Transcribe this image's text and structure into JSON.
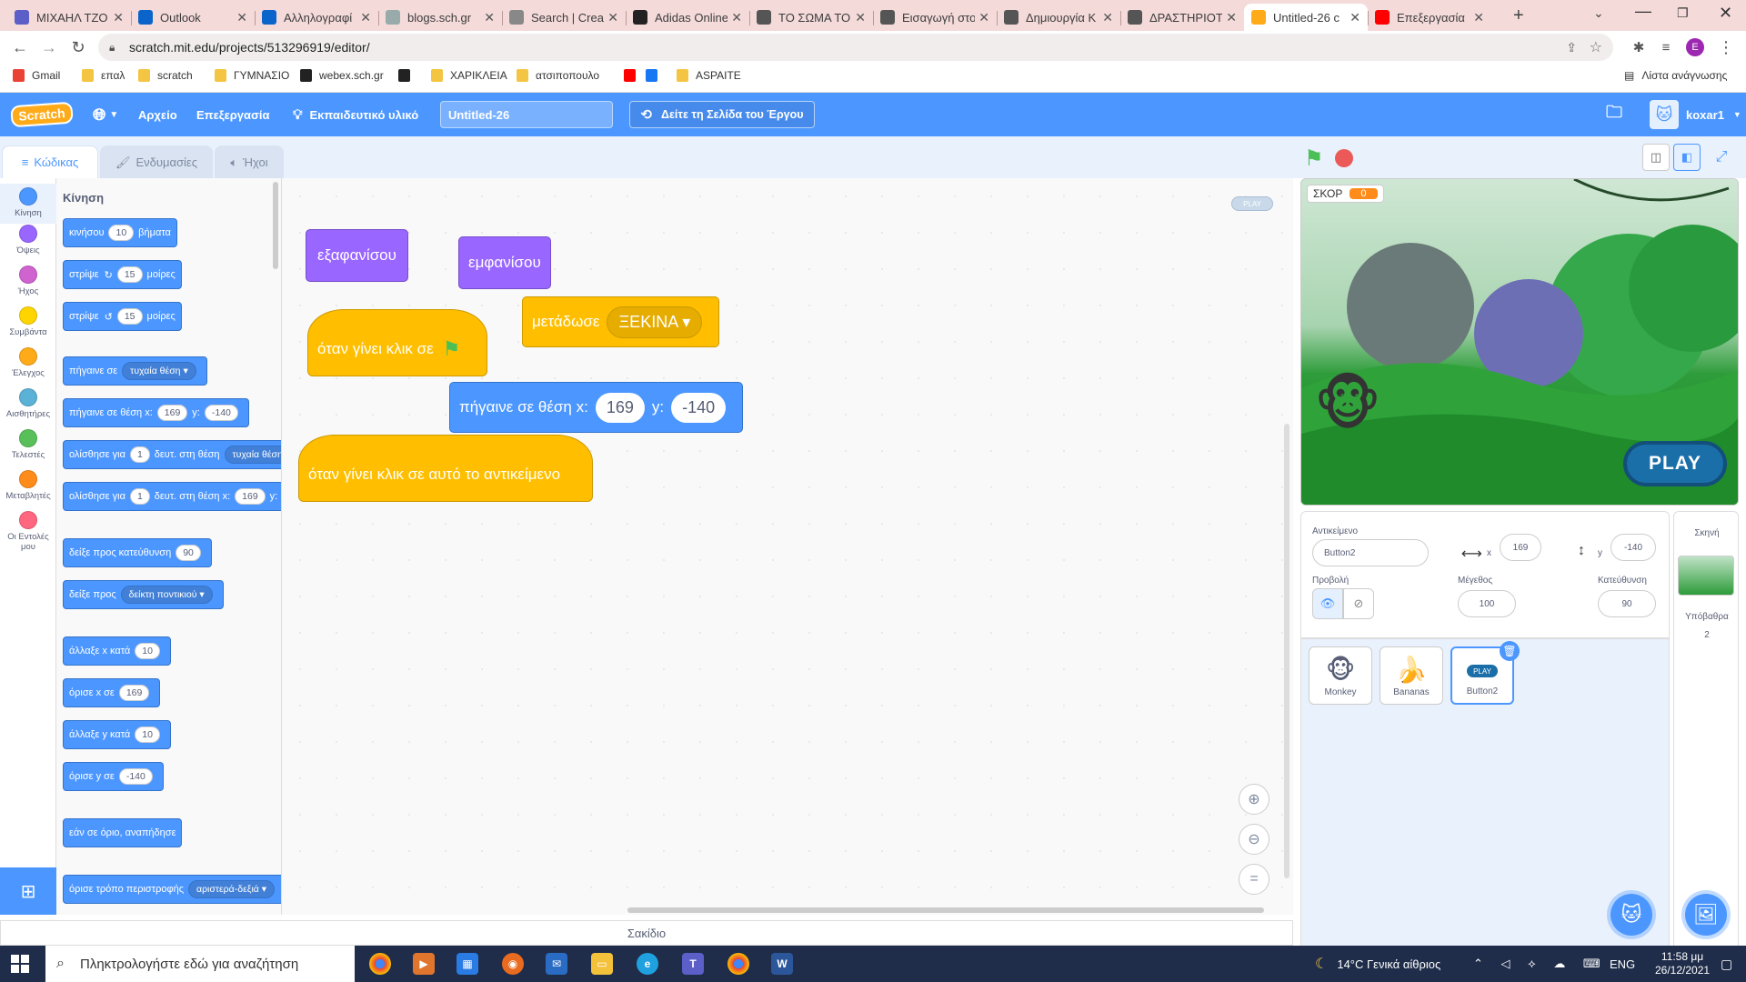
{
  "browser": {
    "tabs": [
      {
        "title": "ΜΙΧΑΗΛ ΤΖΟ",
        "color": "#5b5fc7"
      },
      {
        "title": "Outlook",
        "color": "#0a64c9"
      },
      {
        "title": "Αλληλογραφί",
        "color": "#0a64c9"
      },
      {
        "title": "blogs.sch.gr",
        "color": "#9aa"
      },
      {
        "title": "Search | Crea",
        "color": "#888"
      },
      {
        "title": "Adidas Online",
        "color": "#222"
      },
      {
        "title": "ΤΟ ΣΩΜΑ ΤΟ",
        "color": "#555"
      },
      {
        "title": "Εισαγωγή στο",
        "color": "#555"
      },
      {
        "title": "Δημιουργία Κ",
        "color": "#555"
      },
      {
        "title": "ΔΡΑΣΤΗΡΙΟΤ",
        "color": "#555"
      },
      {
        "title": "Untitled-26 c",
        "color": "#ffab19"
      },
      {
        "title": "Επεξεργασία",
        "color": "#ff0000"
      }
    ],
    "url": "scratch.mit.edu/projects/513296919/editor/",
    "bookmarks": [
      {
        "label": "Gmail",
        "color": "#ea4335"
      },
      {
        "label": "επαλ",
        "color": "#f4c542"
      },
      {
        "label": "scratch",
        "color": "#f4c542"
      },
      {
        "label": "ΓΥΜΝΑΣΙΟ",
        "color": "#f4c542"
      },
      {
        "label": "webex.sch.gr",
        "color": "#222"
      },
      {
        "label": "",
        "color": "#222"
      },
      {
        "label": "ΧΑΡΙΚΛΕΙΑ",
        "color": "#f4c542"
      },
      {
        "label": "ατσιποπουλο",
        "color": "#f4c542"
      },
      {
        "label": "",
        "color": "#ff0000"
      },
      {
        "label": "",
        "color": "#1877f2"
      },
      {
        "label": "ASPAITE",
        "color": "#f4c542"
      }
    ],
    "reading_list": "Λίστα ανάγνωσης",
    "profile_letter": "E"
  },
  "scratch": {
    "logo": "Scratch",
    "menu_file": "Αρχείο",
    "menu_edit": "Επεξεργασία",
    "tutorials": "Εκπαιδευτικό υλικό",
    "project_title": "Untitled-26",
    "see_project": "Δείτε τη Σελίδα του Έργου",
    "username": "koxar1",
    "tab_code": "Κώδικας",
    "tab_costumes": "Ενδυμασίες",
    "tab_sounds": "Ήχοι",
    "categories": [
      {
        "label": "Κίνηση",
        "color": "#4c97ff"
      },
      {
        "label": "Όψεις",
        "color": "#9966ff"
      },
      {
        "label": "Ήχος",
        "color": "#cf63cf"
      },
      {
        "label": "Συμβάντα",
        "color": "#ffd500"
      },
      {
        "label": "Έλεγχος",
        "color": "#ffab19"
      },
      {
        "label": "Αισθητήρες",
        "color": "#5cb1d6"
      },
      {
        "label": "Τελεστές",
        "color": "#59c059"
      },
      {
        "label": "Μεταβλητές",
        "color": "#ff8c1a"
      },
      {
        "label": "Οι Εντολές μου",
        "color": "#ff6680"
      }
    ],
    "palette_title": "Κίνηση",
    "palette": {
      "move": [
        "κινήσου",
        "10",
        "βήματα"
      ],
      "turn_right": [
        "στρίψε",
        "15",
        "μοίρες"
      ],
      "turn_left": [
        "στρίψε",
        "15",
        "μοίρες"
      ],
      "goto": [
        "πήγαινε σε",
        "τυχαία θέση"
      ],
      "goto_xy": [
        "πήγαινε σε θέση x:",
        "169",
        "y:",
        "-140"
      ],
      "glide": [
        "ολίσθησε για",
        "1",
        "δευτ. στη θέση",
        "τυχαία θέση"
      ],
      "glide_xy": [
        "ολίσθησε για",
        "1",
        "δευτ. στη θέση x:",
        "169",
        "y:"
      ],
      "point_dir": [
        "δείξε προς κατεύθυνση",
        "90"
      ],
      "point_towards": [
        "δείξε προς",
        "δείκτη ποντικιού"
      ],
      "change_x": [
        "άλλαξε x κατά",
        "10"
      ],
      "set_x": [
        "όρισε x σε",
        "169"
      ],
      "change_y": [
        "άλλαξε y κατά",
        "10"
      ],
      "set_y": [
        "όρισε y σε",
        "-140"
      ],
      "bounce": "εάν σε όριο, αναπήδησε",
      "rotation": [
        "όρισε τρόπο περιστροφής",
        "αριστερά-δεξιά"
      ]
    },
    "script": {
      "hide": "εξαφανίσου",
      "show": "εμφανίσου",
      "broadcast": [
        "μετάδωσε",
        "ΞΕΚΙΝΑ"
      ],
      "when_flag": "όταν γίνει κλικ σε",
      "goto": [
        "πήγαινε σε θέση x:",
        "169",
        "y:",
        "-140"
      ],
      "when_clicked": "όταν γίνει κλικ σε αυτό το αντικείμενο",
      "play_preview": "PLAY"
    },
    "backpack": "Σακίδιο",
    "stage": {
      "score_label": "ΣΚΟΡ",
      "score_value": "0",
      "play_button": "PLAY"
    },
    "sprite_info": {
      "label_sprite": "Αντικείμενο",
      "name": "Button2",
      "label_x": "x",
      "x": "169",
      "label_y": "y",
      "y": "-140",
      "label_show": "Προβολή",
      "label_size": "Μέγεθος",
      "size": "100",
      "label_direction": "Κατεύθυνση",
      "direction": "90"
    },
    "sprites": [
      {
        "name": "Monkey",
        "icon": "🐵"
      },
      {
        "name": "Bananas",
        "icon": "🍌"
      },
      {
        "name": "Button2",
        "icon": "PLAY"
      }
    ],
    "stage_pane": {
      "title": "Σκηνή",
      "backdrops_label": "Υπόβαθρα",
      "backdrops_count": "2"
    }
  },
  "taskbar": {
    "search_placeholder": "Πληκτρολογήστε εδώ για αναζήτηση",
    "weather": "14°C  Γενικά αίθριος",
    "lang": "ENG",
    "time": "11:58 μμ",
    "date": "26/12/2021"
  }
}
